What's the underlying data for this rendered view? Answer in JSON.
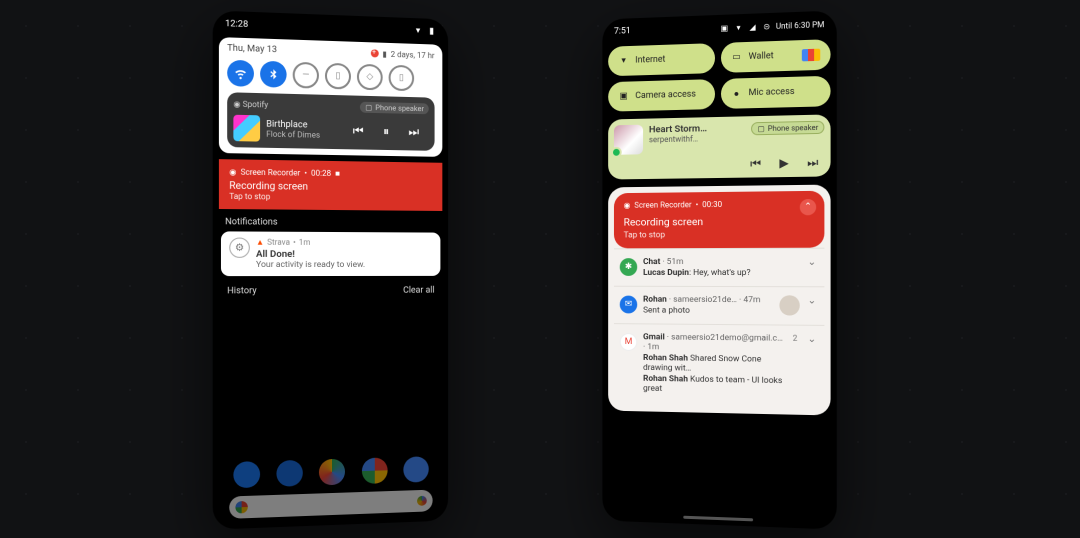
{
  "left": {
    "status": {
      "time": "12:28"
    },
    "qs": {
      "date": "Thu, May 13",
      "battery_text": "2 days, 17 hr",
      "tiles": [
        "wifi",
        "bluetooth",
        "dnd",
        "flashlight",
        "rotate",
        "battery-saver"
      ]
    },
    "media": {
      "app": "Spotify",
      "output": "Phone speaker",
      "track": "Birthplace",
      "artist": "Flock of Dimes"
    },
    "recorder": {
      "app": "Screen Recorder",
      "time": "00:28",
      "title": "Recording screen",
      "sub": "Tap to stop"
    },
    "section_notifications": "Notifications",
    "strava": {
      "app": "Strava",
      "age": "1m",
      "title": "All Done!",
      "sub": "Your activity is ready to view."
    },
    "history_label": "History",
    "clear_all": "Clear all"
  },
  "right": {
    "status": {
      "time": "7:51",
      "dnd": "Until 6:30 PM"
    },
    "tiles": {
      "internet": "Internet",
      "wallet": "Wallet",
      "camera": "Camera access",
      "mic": "Mic access"
    },
    "media": {
      "track": "Heart Storm…",
      "artist": "serpentwithf…",
      "output": "Phone speaker"
    },
    "recorder": {
      "app": "Screen Recorder",
      "time": "00:30",
      "title": "Recording screen",
      "sub": "Tap to stop"
    },
    "chat": {
      "app": "Chat",
      "age": "51m",
      "sender": "Lucas Dupin",
      "msg": "Hey, what's up?"
    },
    "rohan": {
      "name": "Rohan",
      "handle": "sameersio21de…",
      "age": "47m",
      "sub": "Sent a photo"
    },
    "gmail": {
      "app": "Gmail",
      "addr": "sameersio21demo@gmail.c…",
      "age": "1m",
      "count": "2",
      "line1_sender": "Rohan Shah",
      "line1_rest": "Shared Snow Cone drawing wit…",
      "line2_sender": "Rohan Shah",
      "line2_rest": "Kudos to team - UI looks great"
    }
  }
}
